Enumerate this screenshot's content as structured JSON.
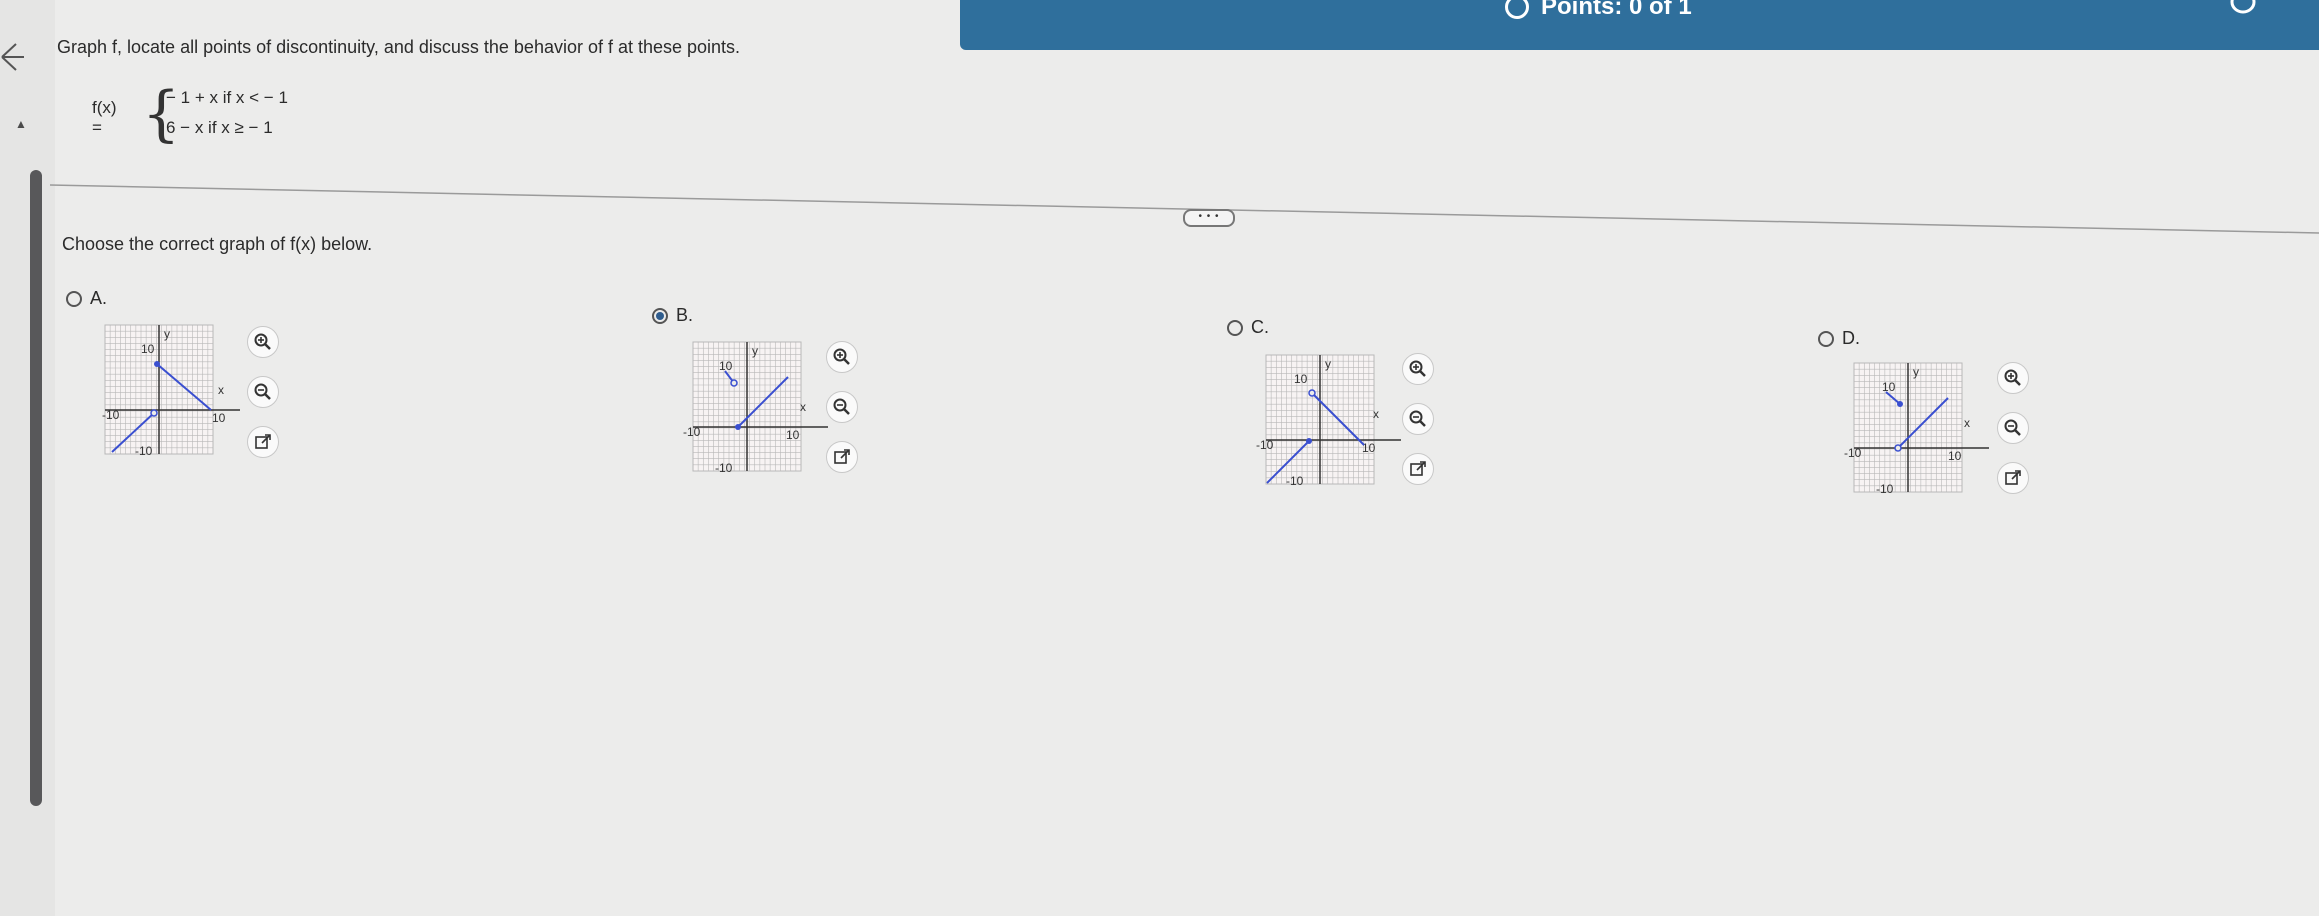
{
  "header": {
    "points_text": "Points: 0 of 1"
  },
  "question": {
    "text": "Graph f, locate all points of discontinuity, and discuss the behavior of f at these points.",
    "function_name": "f(x) =",
    "case1": "− 1 + x  if x < − 1",
    "case2": "6 − x  if x ≥ − 1"
  },
  "divider_handle": "• • •",
  "prompt": "Choose the correct graph of f(x) below.",
  "options": [
    {
      "letter": "A.",
      "selected": false,
      "graph": {
        "y_label": "y",
        "x_label": "x",
        "tick_pos": "10",
        "tick_neg": "-10"
      }
    },
    {
      "letter": "B.",
      "selected": true,
      "graph": {
        "y_label": "y",
        "x_label": "x",
        "tick_pos": "10",
        "tick_neg": "-10"
      }
    },
    {
      "letter": "C.",
      "selected": false,
      "graph": {
        "y_label": "y",
        "x_label": "x",
        "tick_pos": "10",
        "tick_neg": "-10"
      }
    },
    {
      "letter": "D.",
      "selected": false,
      "graph": {
        "y_label": "y",
        "x_label": "x",
        "tick_pos": "10",
        "tick_neg": "-10"
      }
    }
  ],
  "icons": {
    "zoom_in": "zoom-in-icon",
    "zoom_out": "zoom-out-icon",
    "popout": "external-link-icon"
  },
  "colors": {
    "header": "#2f6f9c",
    "curve": "#3a4fd0",
    "grid": "#b8b8b8",
    "accent": "#2f5d8e"
  }
}
